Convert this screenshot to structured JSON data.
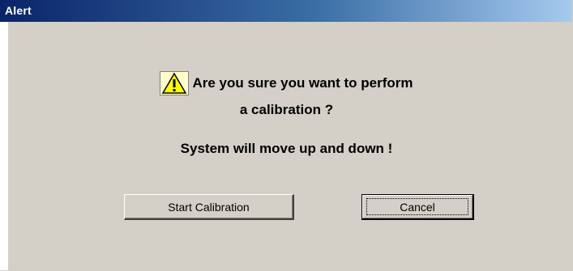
{
  "window": {
    "title": "Alert"
  },
  "message": {
    "line1": "Are you sure you want to perform",
    "line2": "a calibration ?",
    "line3": "System will move up and down !",
    "icon": "warning-icon"
  },
  "buttons": {
    "start_label": "Start Calibration",
    "cancel_label": "Cancel"
  },
  "colors": {
    "titlebar_start": "#0a246a",
    "titlebar_end": "#a6caf0",
    "dialog_bg": "#d4d0c8",
    "warning_yellow": "#ffff00"
  }
}
